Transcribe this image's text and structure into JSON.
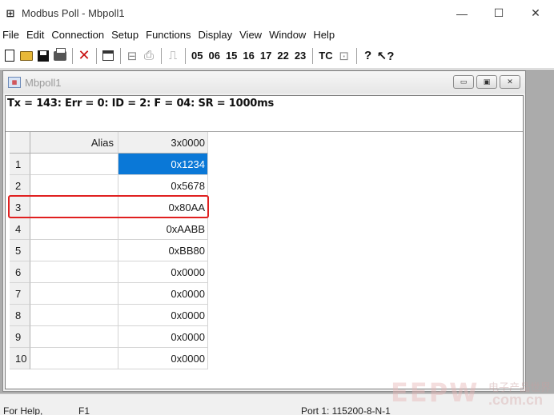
{
  "window": {
    "title": "Modbus Poll - Mbpoll1",
    "app_icon": "modbus-app-icon",
    "controls": {
      "minimize": "—",
      "maximize": "☐",
      "close": "✕"
    }
  },
  "menu": [
    "File",
    "Edit",
    "Connection",
    "Setup",
    "Functions",
    "Display",
    "View",
    "Window",
    "Help"
  ],
  "toolbar": {
    "function_codes": [
      "05",
      "06",
      "15",
      "16",
      "17",
      "22",
      "23"
    ],
    "tc_label": "TC"
  },
  "child_window": {
    "title": "Mbpoll1",
    "status_line": "Tx = 143: Err = 0: ID = 2: F = 04: SR = 1000ms",
    "columns": {
      "alias": "Alias",
      "address": "3x0000"
    },
    "rows": [
      {
        "num": "1",
        "alias": "",
        "value": "0x1234"
      },
      {
        "num": "2",
        "alias": "",
        "value": "0x5678"
      },
      {
        "num": "3",
        "alias": "",
        "value": "0x80AA"
      },
      {
        "num": "4",
        "alias": "",
        "value": "0xAABB"
      },
      {
        "num": "5",
        "alias": "",
        "value": "0xBB80"
      },
      {
        "num": "6",
        "alias": "",
        "value": "0x0000"
      },
      {
        "num": "7",
        "alias": "",
        "value": "0x0000"
      },
      {
        "num": "8",
        "alias": "",
        "value": "0x0000"
      },
      {
        "num": "9",
        "alias": "",
        "value": "0x0000"
      },
      {
        "num": "10",
        "alias": "",
        "value": "0x0000"
      }
    ],
    "selected_row": 1,
    "highlighted_row": 3
  },
  "statusbar": {
    "left": "For Help,",
    "mid": "F1",
    "right": "Port 1: 115200-8-N-1"
  },
  "watermark": {
    "logo": "EEPW",
    "cn": "电子产品世界",
    "url": ".com.cn"
  },
  "colors": {
    "selection": "#0a78d7",
    "highlight_border": "#e02020",
    "mdi_background": "#ababab"
  }
}
